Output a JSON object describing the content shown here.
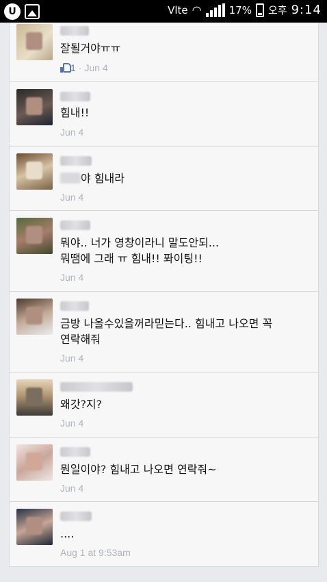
{
  "status_bar": {
    "app_badge": "U",
    "network": "Vlte",
    "battery": "17%",
    "ampm": "오후",
    "time": "9:14"
  },
  "comments": [
    {
      "text_lines": [
        "잘될거야ㅠㅠ"
      ],
      "like_count": "1",
      "separator": "·",
      "date": "Jun 4"
    },
    {
      "text_lines": [
        "힘내!!"
      ],
      "date": "Jun 4"
    },
    {
      "text_lines": [
        "야 힘내라"
      ],
      "date": "Jun 4"
    },
    {
      "text_lines": [
        "뭐야.. 너가 영창이라니 말도안되...",
        "뭐땜에 그래 ㅠ 힘내!! 퐈이팅!!"
      ],
      "date": "Jun 4"
    },
    {
      "text_lines": [
        "금방 나올수있을꺼라믿는다.. 힘내고 나오면 꼭",
        "연락해줘"
      ],
      "date": "Jun 4"
    },
    {
      "text_lines": [
        "왜갓?지?"
      ],
      "date": "Jun 4"
    },
    {
      "text_lines": [
        "뭔일이야? 힘내고 나오면 연락줘~"
      ],
      "date": "Jun 4"
    },
    {
      "text_lines": [
        "...."
      ],
      "date": "Aug 1 at 9:53am"
    }
  ]
}
